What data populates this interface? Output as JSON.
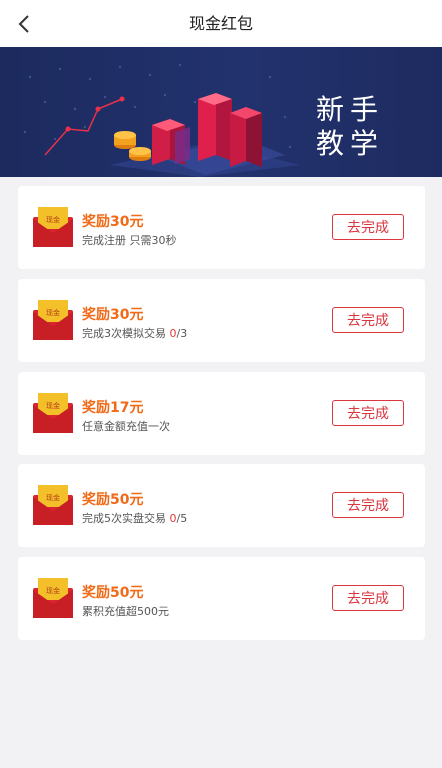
{
  "header": {
    "title": "现金红包",
    "back_icon": "chevron-left-icon"
  },
  "banner": {
    "line1": "新手",
    "line2": "教学"
  },
  "colors": {
    "reward": "#f06a18",
    "button": "#d9363e",
    "highlight": "#e23a3a"
  },
  "tasks": [
    {
      "reward": "奖励30元",
      "desc": "完成注册 只需30秒",
      "button": "去完成",
      "envelope_label": "现金"
    },
    {
      "reward": "奖励30元",
      "desc_prefix": "完成3次模拟交易 ",
      "progress": "0",
      "total": "/3",
      "button": "去完成",
      "envelope_label": "现金"
    },
    {
      "reward": "奖励17元",
      "desc": "任意金额充值一次",
      "button": "去完成",
      "envelope_label": "现金"
    },
    {
      "reward": "奖励50元",
      "desc_prefix": "完成5次实盘交易 ",
      "progress": "0",
      "total": "/5",
      "button": "去完成",
      "envelope_label": "现金"
    },
    {
      "reward": "奖励50元",
      "desc": "累积充值超500元",
      "button": "去完成",
      "envelope_label": "现金"
    }
  ]
}
